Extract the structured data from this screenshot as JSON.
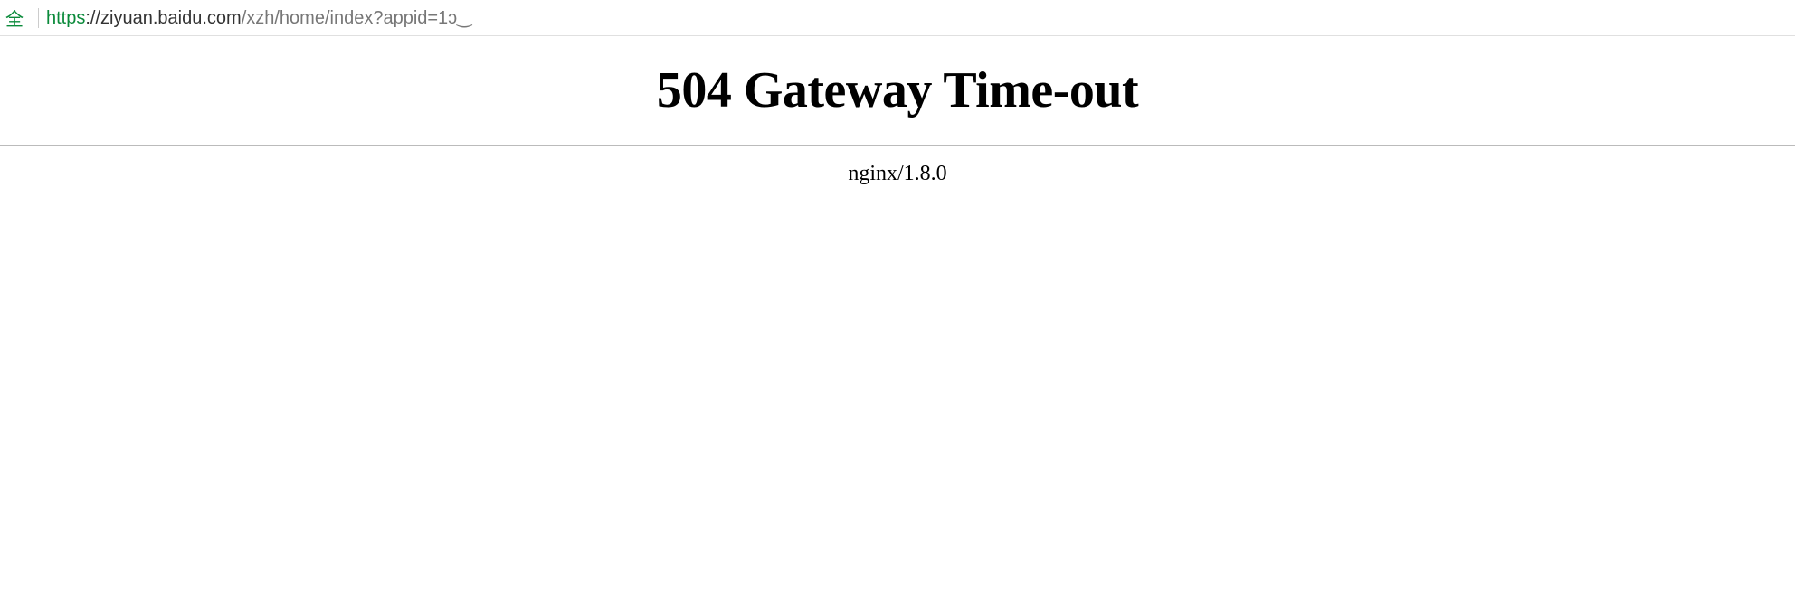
{
  "addressBar": {
    "secureLabel": "全",
    "urlScheme": "https",
    "urlHost": "://ziyuan.baidu.com",
    "urlPath": "/xzh/home/index?appid=1ɔ‿"
  },
  "page": {
    "errorTitle": "504 Gateway Time-out",
    "serverInfo": "nginx/1.8.0"
  }
}
